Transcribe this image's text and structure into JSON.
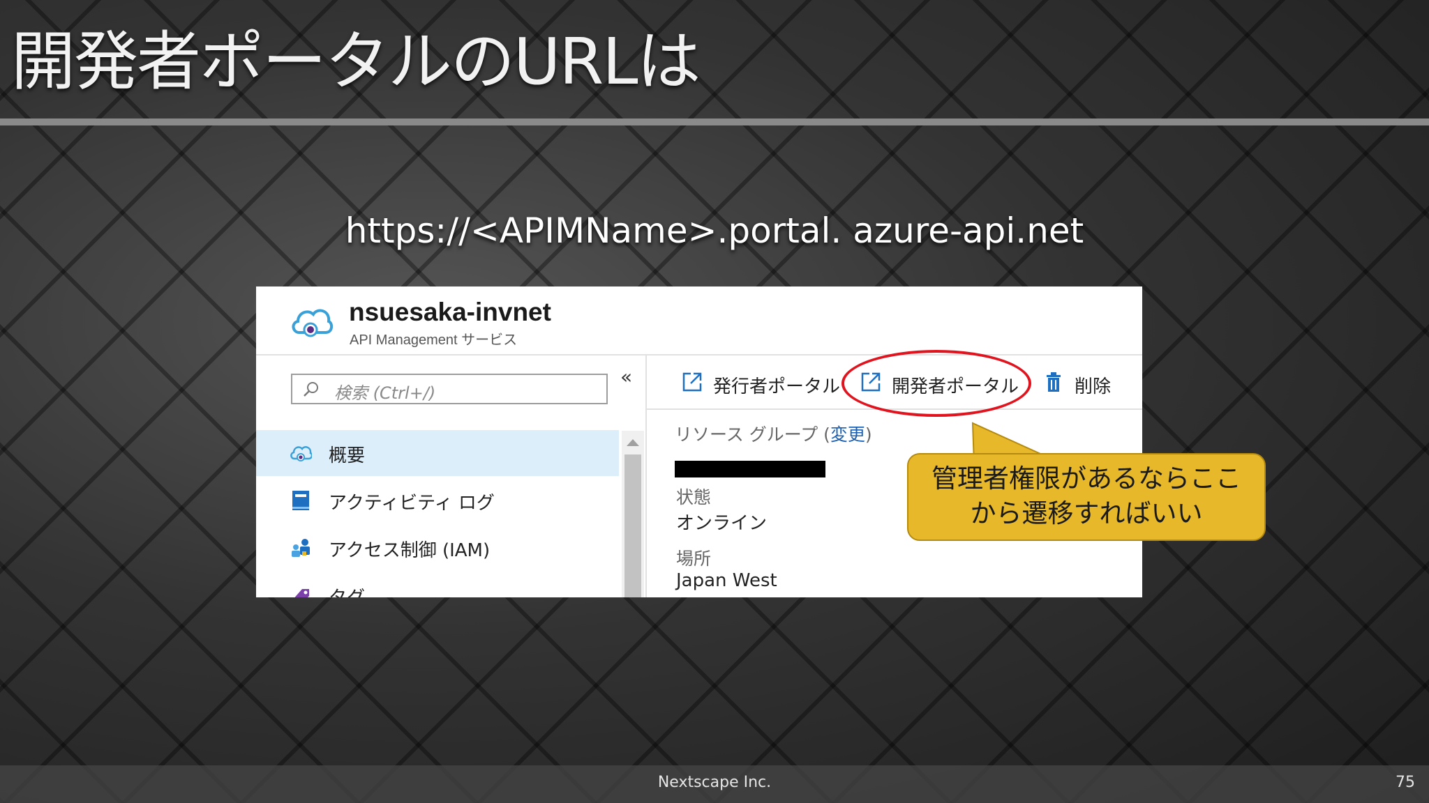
{
  "slide": {
    "title": "開発者ポータルのURLは",
    "url": "https://<APIMName>.portal. azure-api.net",
    "footer": "Nextscape Inc.",
    "page_number": "75"
  },
  "portal": {
    "resource_name": "nsuesaka-invnet",
    "resource_type": "API Management サービス",
    "search_placeholder": "検索 (Ctrl+/)",
    "collapse_glyph": "«",
    "nav_items": [
      {
        "label": "概要",
        "icon": "cloud-icon",
        "selected": true
      },
      {
        "label": "アクティビティ ログ",
        "icon": "log-book-icon",
        "selected": false
      },
      {
        "label": "アクセス制御 (IAM)",
        "icon": "users-icon",
        "selected": false
      },
      {
        "label": "タグ",
        "icon": "tag-icon",
        "selected": false
      }
    ],
    "toolbar": {
      "publisher_portal": "発行者ポータル",
      "developer_portal": "開発者ポータル",
      "delete": "削除"
    },
    "properties": {
      "resource_group_label": "リソース グループ (",
      "resource_group_link": "変更",
      "resource_group_close": ")",
      "status_label": "状態",
      "status_value": "オンライン",
      "location_label": "場所",
      "location_value": "Japan West"
    }
  },
  "callout": {
    "line1": "管理者権限があるならここ",
    "line2": "から遷移すればいい"
  },
  "colors": {
    "accent_blue": "#0078d4",
    "highlight_red": "#e0141e",
    "callout_yellow": "#e6b82a",
    "selected_bg": "#dceefa"
  }
}
